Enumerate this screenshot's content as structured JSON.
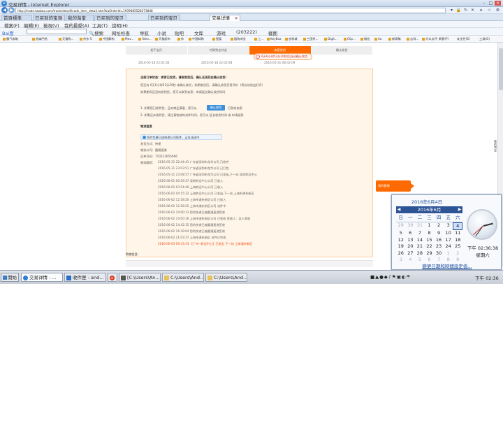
{
  "window": {
    "title": "交易详情 - Internet Explorer"
  },
  "address": {
    "url": "http://trade.taobao.com/trade/detail/trade_item_detail.htm?bizOrderId=1939485528573848"
  },
  "tabs": [
    {
      "label": "首頁標準"
    },
    {
      "label": "已买到的宝贝"
    },
    {
      "label": "我的淘宝"
    },
    {
      "label": "已买到的宝贝"
    },
    {
      "label": "已买到的宝贝"
    },
    {
      "label": "交易详情"
    }
  ],
  "menu": {
    "items": [
      "檔案(F)",
      "編輯(E)",
      "檢視(V)",
      "我的最愛(A)",
      "工具(T)",
      "說明(H)"
    ]
  },
  "searchbar": {
    "brand": "Bai度",
    "search_btn": "搜索",
    "items": [
      "网址检查",
      "导航",
      "小说",
      "贴吧",
      "文库",
      "游戏",
      "(203222)",
      "截图"
    ]
  },
  "favorites": [
    "霸气攻略",
    "首扁門热",
    "天猫购...",
    "京东-5",
    "中国解构",
    "Mov...",
    "Yaho...",
    "天猫超市",
    "你",
    "中国邮购",
    "图爱",
    "搜狗浏览",
    "上...",
    "KeyBoa",
    "农科城",
    "三国杀...",
    "Digit...",
    "Clip...",
    "微信",
    "Aa",
    "新闻稿",
    "吉祥...",
    "大众点评"
  ],
  "fav_right": [
    "網頁(P)",
    "安全性(S)",
    "工具(O)"
  ],
  "steps": {
    "labels": [
      "拍下宝贝",
      "付款到支付宝",
      "卖家发货",
      "确认收货"
    ],
    "dates": [
      "2016-05-18 22:02:36",
      "2016-05-18 22:02:48",
      "2016-05-31 08:42:09"
    ],
    "note": "6天6小时53分20秒后自动确认收货"
  },
  "panel": {
    "status": "当前订单状态：卖家已发货，请收到货后，确认无误后在确认收货！",
    "line1": "您还有 6天6小时53分20秒 来确认收货，如期收货后，请确认收货后再评价（将自动给出好评）",
    "line2": "如果期间还没有收到货，您可以联系卖家，申请延长确认收货时间",
    "step1": "1. 如果您已收到货，且对商品满意，您可以",
    "ok_btn": "确认收货",
    "step1b": "打款给卖家",
    "step2": "2. 如果还未收到货，请注意物流的派件时间，您可以 延长收货时间 或 申请退款",
    "logistics_title": "物流信息",
    "infobox": "您的包裹已由快递公司揽件，正在派送中",
    "company_label": "发货方式：快递",
    "company_name": "物流公司：圆通速递",
    "tracking_no": "运单号码：710223655966",
    "track_label": "物流跟踪："
  },
  "tracking": [
    "2016-05-31 22:44:41 广东省深圳市龙华公司 已收件",
    "2016-05-31 23:03:51 广东省深圳市龙华公司 已打包",
    "2016-05-31 23:08:57 广东省深圳市龙华公司 已发出,下一站 深圳转运中心",
    "2016-06-01 00:29:37 深圳转运中心公司 已收入",
    "2016-06-02 03:54:40 上海转运中心公司 已收入",
    "2016-06-02 04:15:32 上海转运中心公司 已发出,下一站 上海市浦东新区",
    "2016-06-02 12:58:20 上海市浦东新区公司 已收入",
    "2016-06-02 12:58:25 上海市浦东新区公司 派件中",
    "2016-06-02 14:00:13 您的快递已被圆通速递签收",
    "2016-06-02 14:00:16 上海市浦东新区公司 已签收 签收人：本人签收",
    "2016-06-02 14:42:15 您的快递已被圆通速递签收",
    "2016-06-02 16:39:04 您的快递已被圆通速递签收",
    "2016-06-02 21:03:37 上海市浦东新区 派件已完成",
    "2016-06-03 09:33:33 【广州--转运中心】已发出 下一站 上海浦东新区"
  ],
  "kefu": "我的客服",
  "sidetab": "我的淘宝",
  "bottom_label": "购物信息：",
  "taskbar": {
    "start": "開始",
    "buttons": [
      "交易详情 - ...",
      "收件匣 - and...",
      "",
      "[C:\\Users\\An...",
      "C:\\Users\\And...",
      "C:\\Users\\And..."
    ],
    "clock": "下午 02:36"
  },
  "calendar": {
    "date_long": "2016年6月4日",
    "month": "2016年6月",
    "weekdays": [
      "日",
      "一",
      "二",
      "三",
      "四",
      "五",
      "六"
    ],
    "weeks": [
      [
        "29",
        "30",
        "31",
        "1",
        "2",
        "3",
        "4"
      ],
      [
        "5",
        "6",
        "7",
        "8",
        "9",
        "10",
        "11"
      ],
      [
        "12",
        "13",
        "14",
        "15",
        "16",
        "17",
        "18"
      ],
      [
        "19",
        "20",
        "21",
        "22",
        "23",
        "24",
        "25"
      ],
      [
        "26",
        "27",
        "28",
        "29",
        "30",
        "1",
        "2"
      ],
      [
        "3",
        "4",
        "5",
        "6",
        "7",
        "8",
        "9"
      ]
    ],
    "time": "下午 02:36:38",
    "weekday": "星期六",
    "footer": "變更日期和時間設定值..."
  },
  "colors": {
    "accent": "#ff6a00",
    "link": "#1e4f9c",
    "panel_bg": "#fff5e8"
  }
}
